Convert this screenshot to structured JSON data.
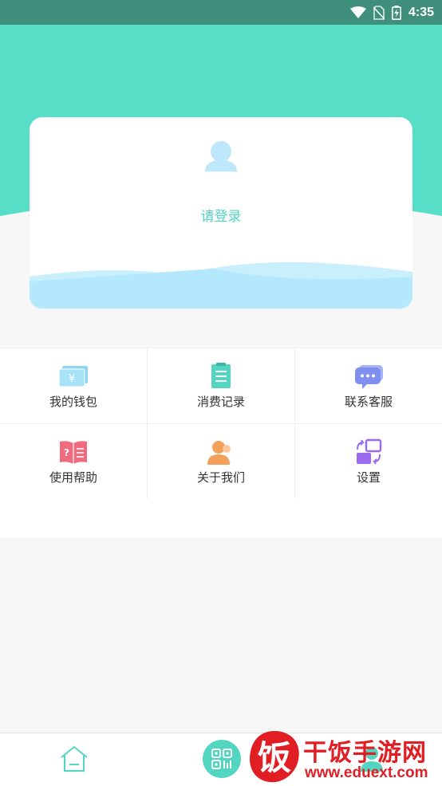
{
  "status_bar": {
    "time": "4:35",
    "icons": [
      "wifi-icon",
      "no-sim-icon",
      "battery-charging-icon"
    ]
  },
  "login_card": {
    "prompt": "请登录",
    "avatar_icon": "user-avatar-icon"
  },
  "menu": [
    {
      "label": "我的钱包",
      "icon": "wallet-icon"
    },
    {
      "label": "消费记录",
      "icon": "receipt-icon"
    },
    {
      "label": "联系客服",
      "icon": "chat-bubble-icon"
    },
    {
      "label": "使用帮助",
      "icon": "help-book-icon"
    },
    {
      "label": "关于我们",
      "icon": "about-user-icon"
    },
    {
      "label": "设置",
      "icon": "settings-switch-icon"
    }
  ],
  "tab_bar": {
    "items": [
      "home-icon",
      "scan-qr-icon",
      "mine-icon"
    ]
  },
  "watermark": {
    "logo_char": "饭",
    "name": "干饭手游网",
    "url": "www.eduext.com"
  },
  "colors": {
    "accent": "#52d5c1",
    "header": "#56dfc6",
    "status_bar": "#3f8f7c",
    "wave_light": "#c9effd",
    "wave_dark": "#a8e3fb",
    "watermark": "#e01e24"
  }
}
